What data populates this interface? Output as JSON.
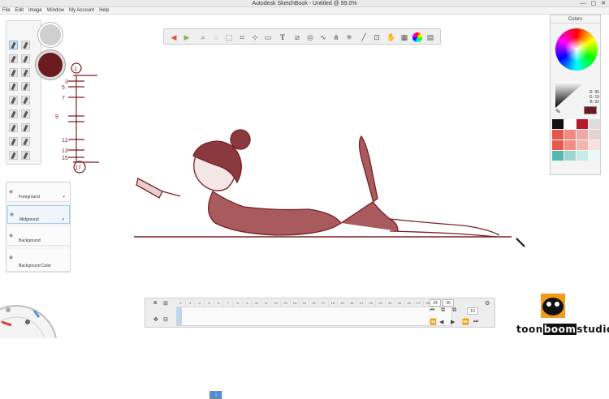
{
  "window": {
    "title": "Autodesk SketchBook - Untitled @ 99.0%",
    "controls": [
      "—",
      "▢",
      "✕"
    ]
  },
  "menu": [
    "File",
    "Edit",
    "Image",
    "Window",
    "My Account",
    "Help"
  ],
  "colors_panel": {
    "title": "Colors",
    "r_label": "R",
    "r": "95",
    "g_label": "G",
    "g": "19",
    "b_label": "B",
    "b": "32",
    "current": "#6b1b1f",
    "palette": [
      "#111111",
      "#ffffff",
      "#b31b2c",
      "#dcdcdc",
      "#e3574f",
      "#f08a80",
      "#eaa9a4",
      "#e7d1d0",
      "#e65a4d",
      "#f28e84",
      "#f3b7b0",
      "#f7e0de",
      "#55b8b0",
      "#9dd6d0",
      "#c9ebe7",
      "#eaf7f6"
    ]
  },
  "layers": [
    {
      "name": "Foreground"
    },
    {
      "name": "Midground"
    },
    {
      "name": "Background"
    },
    {
      "name": "Background Color"
    }
  ],
  "sketch_numbers": [
    "1",
    "3",
    "5",
    "7",
    "9",
    "11",
    "13",
    "15",
    "17"
  ],
  "timeline": {
    "frame_labels": [
      "1",
      "2",
      "3",
      "4",
      "5",
      "6",
      "7",
      "8",
      "9",
      "10",
      "11",
      "12",
      "13",
      "14",
      "15",
      "16",
      "17",
      "18",
      "19",
      "20",
      "21",
      "22",
      "23",
      "24",
      "25",
      "26",
      "27",
      "28",
      "29",
      "30"
    ],
    "current_frame": "24",
    "end_frame": "30",
    "fps": "10"
  },
  "logo": {
    "line1": "toon",
    "line2": "boom",
    "line3": "studio"
  },
  "toolbar_icons": [
    "undo-icon",
    "redo-icon",
    "zoom-icon",
    "lasso-icon",
    "select-icon",
    "crop-icon",
    "transform-icon",
    "text-icon",
    "ruler-icon",
    "ellipse-icon",
    "french-curve-icon",
    "symmetry-icon",
    "perspective-icon",
    "line-icon",
    "shape-icon",
    "fill-icon",
    "gradient-icon",
    "color-icon",
    "layer-icon"
  ]
}
